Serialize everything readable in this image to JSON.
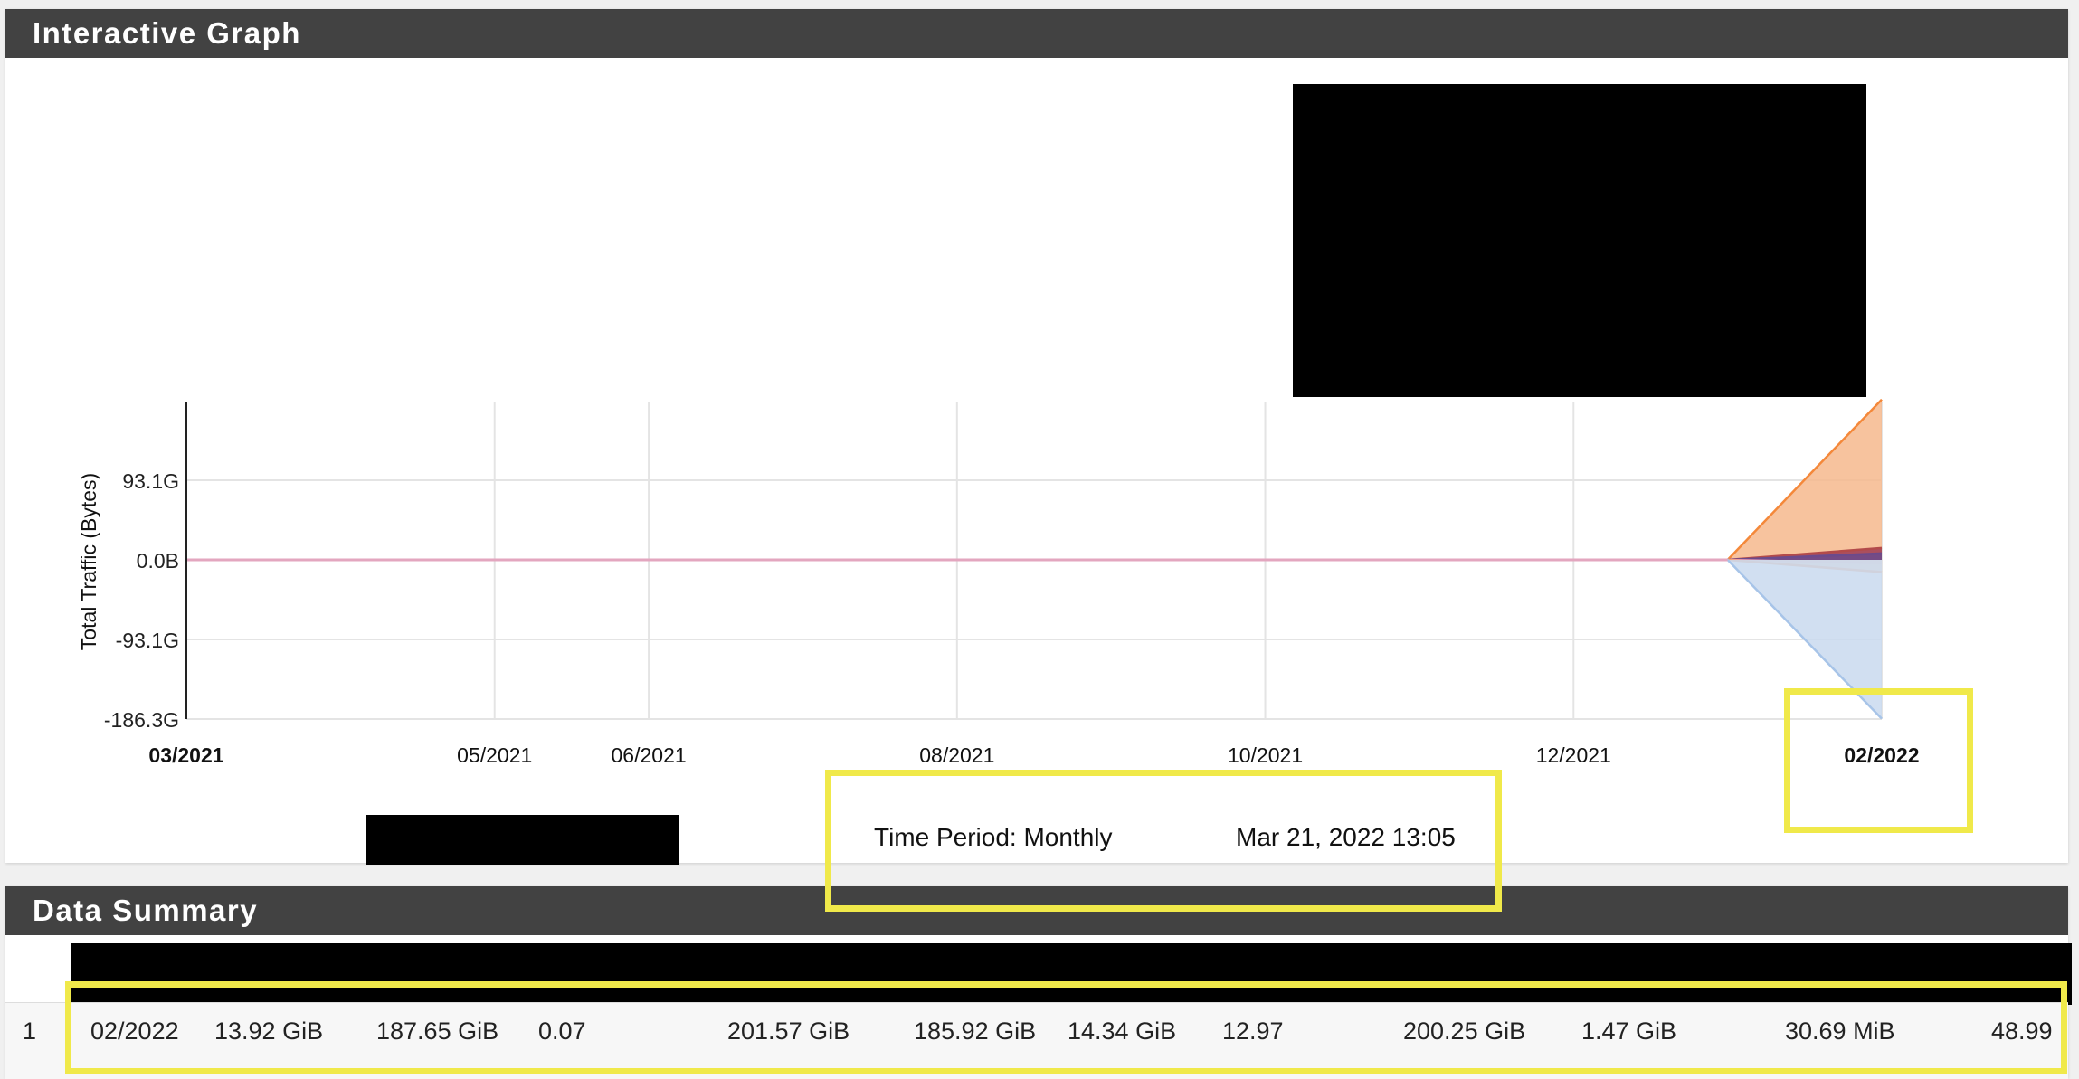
{
  "graph_panel": {
    "title": "Interactive Graph"
  },
  "summary_panel": {
    "title": "Data Summary"
  },
  "caption": {
    "time_period": "Time Period: Monthly",
    "timestamp": "Mar 21, 2022 13:05"
  },
  "chart_data": {
    "type": "area",
    "ylabel": "Total Traffic (Bytes)",
    "y_ticks": [
      "93.1G",
      "0.0B",
      "-93.1G",
      "-186.3G"
    ],
    "y_tick_values": [
      93.1,
      0,
      -93.1,
      -186.3
    ],
    "ylim": [
      -186.3,
      186.3
    ],
    "y_unit": "GB",
    "x_ticks": [
      "03/2021",
      "05/2021",
      "06/2021",
      "08/2021",
      "10/2021",
      "12/2021",
      "02/2022"
    ],
    "x_ticks_bold": [
      "03/2021",
      "02/2022"
    ],
    "x": [
      "03/2021",
      "01/2022",
      "02/2022"
    ],
    "series": [
      {
        "color": "#f4883a",
        "fill": "#f6b88d",
        "values": [
          0,
          0,
          187.65
        ]
      },
      {
        "color": "#b34a4a",
        "fill": "#9c3b52",
        "values": [
          0,
          0,
          13.92
        ]
      },
      {
        "color": "#6b4a8c",
        "fill": "#6b4a8c",
        "values": [
          0,
          0,
          7.5
        ]
      },
      {
        "color": "#e8a0b8",
        "fill": "#f0c8d6",
        "values": [
          0,
          0,
          -4
        ]
      },
      {
        "color": "#f4a57a",
        "fill": "#f8d2b8",
        "values": [
          0,
          0,
          -14.34
        ]
      },
      {
        "color": "#a7c4e8",
        "fill": "#c9d9ef",
        "values": [
          0,
          0,
          -185.92
        ]
      }
    ],
    "grid": true
  },
  "summary_row": {
    "index": "1",
    "cells": [
      "02/2022",
      "13.92 GiB",
      "187.65 GiB",
      "0.07",
      "201.57 GiB",
      "185.92 GiB",
      "14.34 GiB",
      "12.97",
      "200.25 GiB",
      "1.47 GiB",
      "30.69 MiB",
      "48.99"
    ]
  }
}
